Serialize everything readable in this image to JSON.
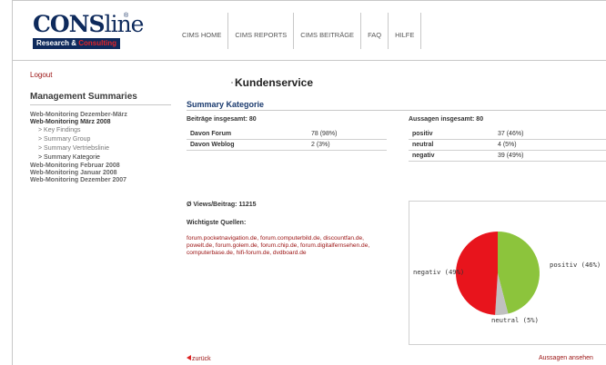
{
  "logo": {
    "word_a": "CONS",
    "word_b": "line",
    "reg": "®",
    "sub_a": "Research & ",
    "sub_b": "Consulting"
  },
  "nav": [
    "CIMS HOME",
    "CIMS REPORTS",
    "CIMS BEITRÄGE",
    "FAQ",
    "HILFE"
  ],
  "sidebar": {
    "logout": "Logout",
    "title": "Management Summaries",
    "items": [
      {
        "label": "Web-Monitoring Dezember-März",
        "type": "section"
      },
      {
        "label": "Web-Monitoring März 2008",
        "type": "section-active"
      },
      {
        "label": "> Key Findings",
        "type": "sub"
      },
      {
        "label": "> Summary Group",
        "type": "sub"
      },
      {
        "label": "> Summary Vertriebslinie",
        "type": "sub"
      },
      {
        "label": "> Summary Kategorie",
        "type": "sub-active"
      },
      {
        "label": "Web-Monitoring Februar 2008",
        "type": "section"
      },
      {
        "label": "Web-Monitoring Januar 2008",
        "type": "section"
      },
      {
        "label": "Web-Monitoring Dezember 2007",
        "type": "section"
      }
    ]
  },
  "main": {
    "heading": "Kundenservice",
    "section_title": "Summary Kategorie",
    "beitraege_head": "Beiträge insgesamt: 80",
    "beitraege": [
      {
        "label": "Davon Forum",
        "value": "78 (98%)"
      },
      {
        "label": "Davon Weblog",
        "value": "2 (3%)"
      }
    ],
    "aussagen_head": "Aussagen insgesamt: 80",
    "aussagen": [
      {
        "label": "positiv",
        "value": "37 (46%)"
      },
      {
        "label": "neutral",
        "value": "4 (5%)"
      },
      {
        "label": "negativ",
        "value": "39 (49%)"
      }
    ],
    "views": "Ø Views/Beitrag: 11215",
    "quellen_head": "Wichtigste Quellen:",
    "quellen": "forum.pocketnavigation.de, forum.computerbild.de, discountfan.de, powelt.de, forum.golem.de, forum.chip.de, forum.digitalfernsehen.de, computerbase.de, hifi-forum.de, dvdboard.de",
    "back": "zurück",
    "next": "Aussagen ansehen"
  },
  "chart_data": {
    "type": "pie",
    "slices": [
      {
        "label": "positiv (46%)",
        "value": 46,
        "color": "#8cc43c"
      },
      {
        "label": "neutral (5%)",
        "value": 5,
        "color": "#c0c0c0"
      },
      {
        "label": "negativ (49%)",
        "value": 49,
        "color": "#e8141c"
      }
    ]
  }
}
